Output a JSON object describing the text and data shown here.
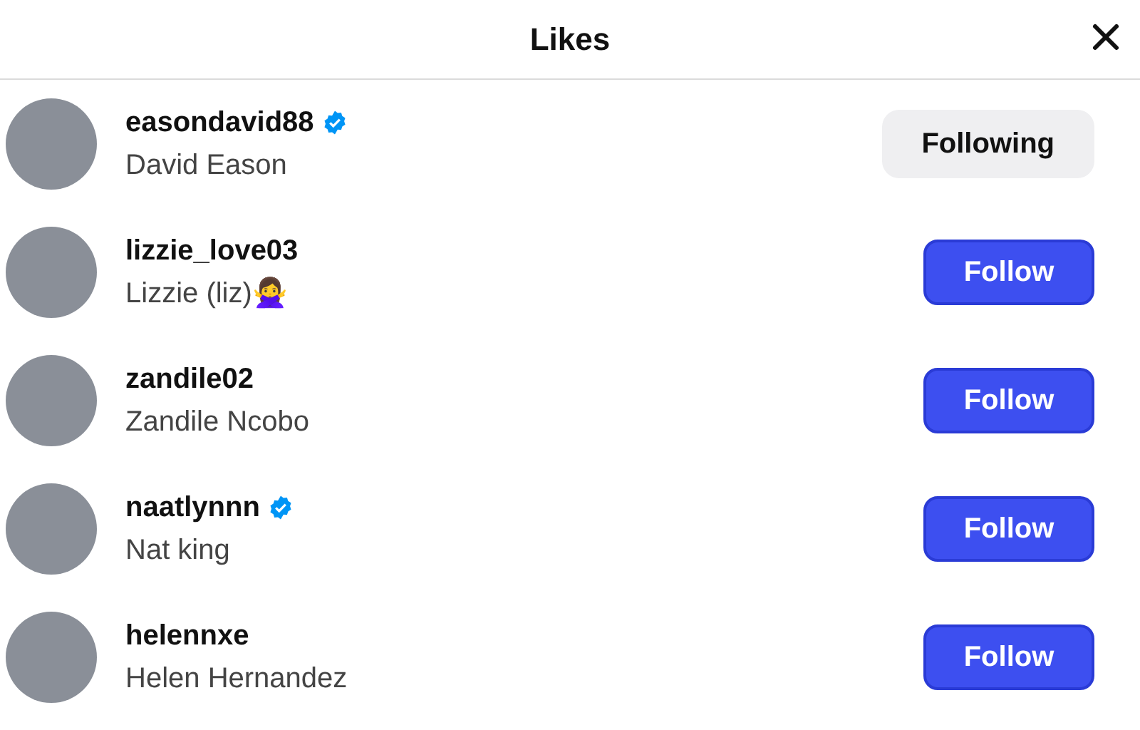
{
  "header": {
    "title": "Likes"
  },
  "users": [
    {
      "username": "easondavid88",
      "verified": true,
      "name": "David Eason",
      "following": true,
      "button": "Following"
    },
    {
      "username": "lizzie_love03",
      "verified": false,
      "name": "Lizzie (liz)🙅‍♀️",
      "following": false,
      "button": "Follow"
    },
    {
      "username": "zandile02",
      "verified": false,
      "name": "Zandile Ncobo",
      "following": false,
      "button": "Follow"
    },
    {
      "username": "naatlynnn",
      "verified": true,
      "name": "Nat king",
      "following": false,
      "button": "Follow"
    },
    {
      "username": "helennxe",
      "verified": false,
      "name": "Helen Hernandez",
      "following": false,
      "button": "Follow"
    }
  ]
}
